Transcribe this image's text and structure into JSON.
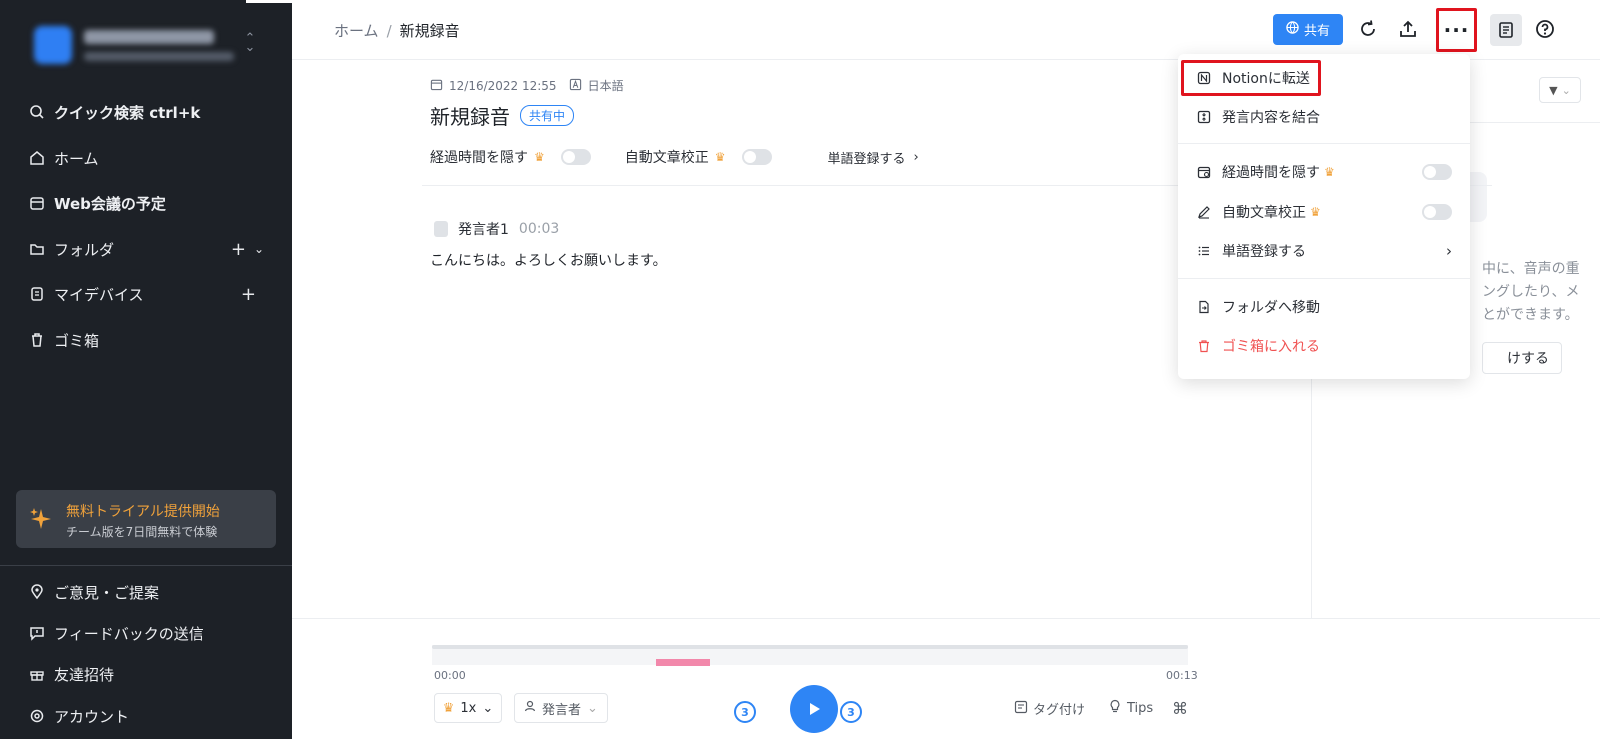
{
  "sidebar": {
    "items": [
      {
        "label": "クイック検索 ctrl+k",
        "icon": "search-icon"
      },
      {
        "label": "ホーム",
        "icon": "home-icon"
      },
      {
        "label": "Web会議の予定",
        "icon": "calendar-icon"
      },
      {
        "label": "フォルダ",
        "icon": "folder-icon"
      },
      {
        "label": "マイデバイス",
        "icon": "device-icon"
      },
      {
        "label": "ゴミ箱",
        "icon": "trash-icon"
      }
    ],
    "trial": {
      "title": "無料トライアル提供開始",
      "subtitle": "チーム版を7日間無料で体験"
    },
    "bottom_items": [
      {
        "label": "ご意見・ご提案",
        "icon": "location-pin-icon"
      },
      {
        "label": "フィードバックの送信",
        "icon": "feedback-icon"
      },
      {
        "label": "友達招待",
        "icon": "gift-icon"
      },
      {
        "label": "アカウント",
        "icon": "settings-icon"
      }
    ]
  },
  "header": {
    "breadcrumb": {
      "home": "ホーム",
      "separator": "/",
      "current": "新規録音"
    },
    "share_label": "共有",
    "more_label": "···"
  },
  "document": {
    "date": "12/16/2022 12:55",
    "language": "日本語",
    "title": "新規録音",
    "share_badge": "共有中",
    "options": {
      "hide_elapsed": "経過時間を隠す",
      "auto_proof": "自動文章校正",
      "word_register": "単語登録する"
    },
    "transcript": [
      {
        "speaker": "発言者1",
        "time": "00:03",
        "text": "こんにちは。よろしくお願いします。"
      }
    ]
  },
  "right_panel": {
    "text_lines": [
      "中に、音声の重",
      "ングしたり、メ",
      "とができます。"
    ],
    "button_label": "けする"
  },
  "player": {
    "time_start": "00:00",
    "time_end": "00:13",
    "speed": "1x",
    "speaker_filter": "発言者",
    "skip_back": "3",
    "skip_forward": "3",
    "tag_label": "タグ付け",
    "tips_label": "Tips"
  },
  "dropdown": {
    "items": [
      {
        "label": "Notionに転送",
        "icon": "notion-icon"
      },
      {
        "label": "発言内容を結合",
        "icon": "merge-icon"
      },
      {
        "label": "経過時間を隠す",
        "icon": "calendar-clock-icon"
      },
      {
        "label": "自動文章校正",
        "icon": "pen-icon"
      },
      {
        "label": "単語登録する",
        "icon": "list-icon"
      },
      {
        "label": "フォルダへ移動",
        "icon": "move-file-icon"
      },
      {
        "label": "ゴミ箱に入れる",
        "icon": "trash-icon"
      }
    ]
  },
  "colors": {
    "accent": "#2e85f5",
    "danger": "#f05252",
    "highlight": "#e0141e",
    "sidebar": "#1d2127",
    "premium": "#f0a23b"
  }
}
